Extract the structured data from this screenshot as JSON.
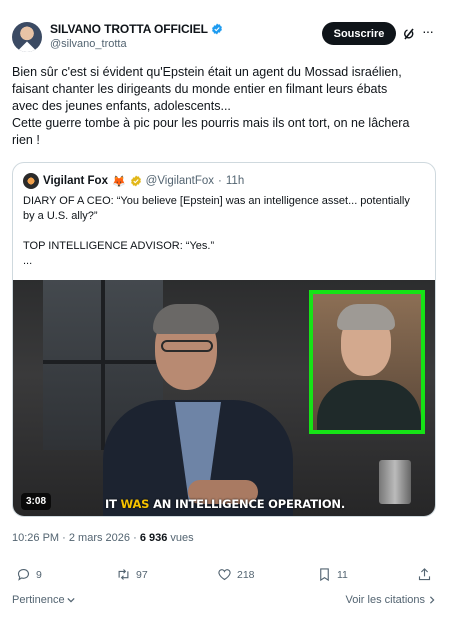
{
  "author": {
    "name": "SILVANO TROTTA OFFICIEL",
    "handle": "@silvano_trotta",
    "verified_color": "#1d9bf0"
  },
  "header": {
    "subscribe_label": "Souscrire"
  },
  "tweet": {
    "line1": "Bien sûr c'est si évident qu'Epstein était un agent du Mossad israélien,",
    "line2": "faisant chanter les dirigeants du monde entier en filmant leurs ébats",
    "line3": "avec des jeunes enfants, adolescents...",
    "line4": "Cette guerre tombe à pic pour les pourris mais ils ont tort, on ne lâchera",
    "line5": "rien !"
  },
  "quote": {
    "name": "Vigilant Fox",
    "emoji": "🦊",
    "handle": "@VigilantFox",
    "time": "11h",
    "separator": "·",
    "gold_badge_color": "#e2b719",
    "text_line1": "DIARY OF A CEO: “You believe [Epstein] was an intelligence asset... potentially",
    "text_line2": "by a U.S. ally?”",
    "text_line3": "TOP INTELLIGENCE ADVISOR: “Yes.”",
    "text_line4": "...",
    "video": {
      "duration": "3:08",
      "subtitle_part1": "IT ",
      "subtitle_highlight": "WAS",
      "subtitle_part2": " AN INTELLIGENCE OPERATION.",
      "highlight_color": "#f6c200",
      "inset_border_color": "#16e316"
    }
  },
  "meta": {
    "time": "10:26 PM",
    "sep": " · ",
    "date": "2 mars 2026",
    "views_count": "6 936",
    "views_label": " vues"
  },
  "actions": {
    "replies": "9",
    "reposts": "97",
    "likes": "218",
    "bookmarks": "11"
  },
  "footer": {
    "sort_label": "Pertinence",
    "citations_label": "Voir les citations"
  }
}
